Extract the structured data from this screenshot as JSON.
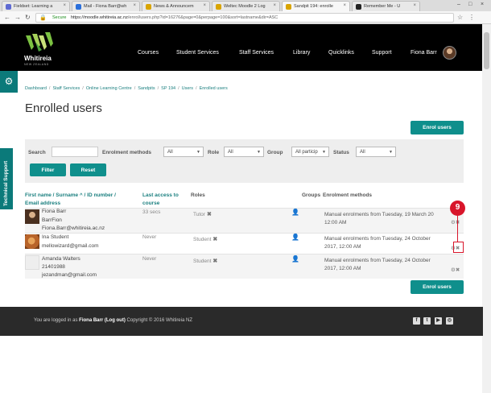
{
  "browser": {
    "tabs": [
      {
        "label": "Fieldset: Learning a",
        "fav": "#5e6ad2"
      },
      {
        "label": "Mail - Fiona Barr@wh",
        "fav": "#2a6fdb"
      },
      {
        "label": "News & Announcem",
        "fav": "#d9a400"
      },
      {
        "label": "Weltec Moodle 2 Log",
        "fav": "#d9a400"
      },
      {
        "label": "Sandpit 194: enrolle",
        "fav": "#d9a400"
      },
      {
        "label": "Remember Me - U",
        "fav": "#222222"
      }
    ],
    "secure_label": "Secure",
    "url_host": "https://moodle.whitireia.ac.nz",
    "url_path": "/enrol/users.php?id=16276&page=0&perpage=100&sort=lastname&dir=ASC"
  },
  "header": {
    "brand": "Whitireia",
    "brand_sub": "NEW ZEALAND",
    "nav": [
      "Courses",
      "Student Services",
      "Staff Services",
      "Library",
      "Quicklinks",
      "Support"
    ],
    "user_name": "Fiona Barr"
  },
  "side": {
    "tech_support": "Technical Support"
  },
  "breadcrumb": [
    "Dashboard",
    "Staff Services",
    "Online Learning Centre",
    "Sandpits",
    "SP 194",
    "Users",
    "Enrolled users"
  ],
  "page_title": "Enrolled users",
  "enrol_button": "Enrol users",
  "filter": {
    "search_label": "Search",
    "methods_label": "Enrolment methods",
    "methods_value": "All",
    "role_label": "Role",
    "role_value": "All",
    "group_label": "Group",
    "group_value": "All particip",
    "status_label": "Status",
    "status_value": "All",
    "filter_button": "Filter",
    "reset_button": "Reset"
  },
  "table": {
    "headers": {
      "name": "First name / Surname",
      "sort_arrow": "^",
      "slash": "/",
      "id": "ID number",
      "slash2": "/",
      "email": "Email address",
      "last_access": "Last access to",
      "last_access2": "course",
      "roles": "Roles",
      "groups": "Groups",
      "methods": "Enrolment methods"
    },
    "rows": [
      {
        "name": "Fiona Barr",
        "id": "BarrFion",
        "email": "Fiona.Barr@whitireia.ac.nz",
        "last_access": "33 secs",
        "role": "Tutor",
        "method": "Manual enrolments from Tuesday, 19 March 20",
        "method_time": "12:00 AM"
      },
      {
        "name": "Ina Student",
        "id": "",
        "email": "mellowizard@gmail.com",
        "last_access": "Never",
        "role": "Student",
        "method": "Manual enrolments from Tuesday, 24 October",
        "method_time": "2017, 12:00 AM"
      },
      {
        "name": "Amanda Walters",
        "id": "21401988",
        "email": "jezandman@gmail.com",
        "last_access": "Never",
        "role": "Student",
        "method": "Manual enrolments from Tuesday, 24 October",
        "method_time": "2017, 12:00 AM"
      }
    ]
  },
  "callout_number": "9",
  "footer": {
    "logged_in_prefix": "You are logged in as",
    "user": "Fiona Barr",
    "logout": "(Log out)",
    "copyright": "Copyright © 2016 Whitireia NZ"
  }
}
